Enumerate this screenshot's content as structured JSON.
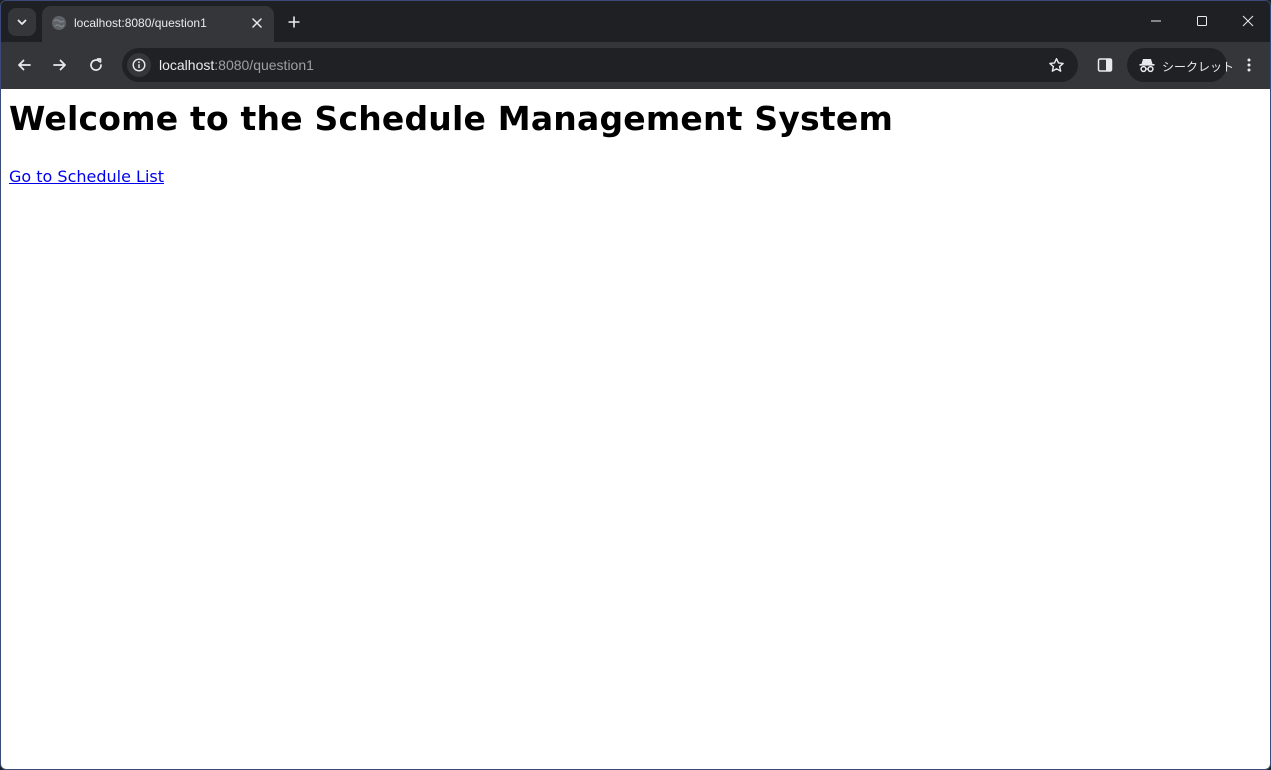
{
  "browser": {
    "tab": {
      "title": "localhost:8080/question1",
      "favicon": "globe-icon"
    },
    "omnibox": {
      "host": "localhost",
      "path": ":8080/question1"
    },
    "profile": {
      "label": "シークレット",
      "icon": "incognito-icon"
    },
    "colors": {
      "frame": "#1f2023",
      "toolbar": "#35363a",
      "omnibox": "#202124"
    }
  },
  "page": {
    "heading": "Welcome to the Schedule Management System",
    "link_label": "Go to Schedule List",
    "link_color": "#0000ee"
  }
}
